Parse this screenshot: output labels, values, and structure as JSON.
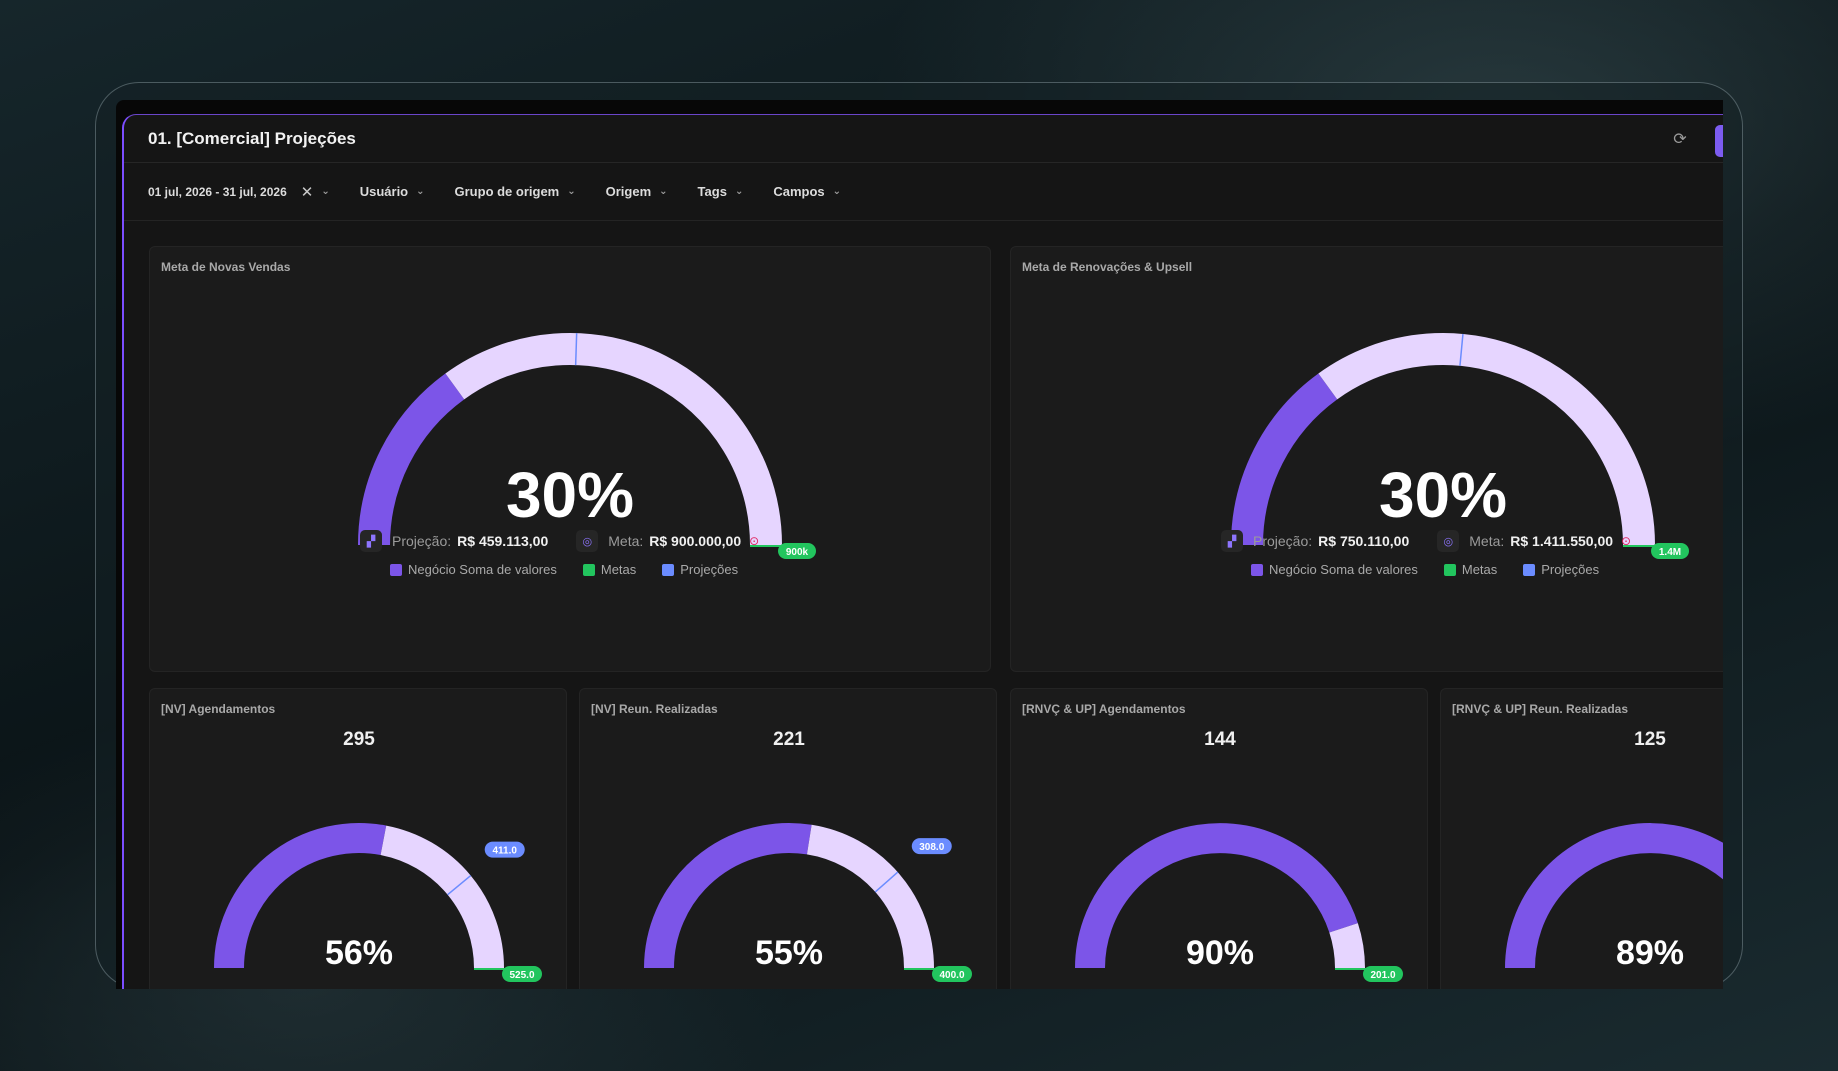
{
  "header": {
    "title": "01. [Comercial] Projeções"
  },
  "filters": {
    "date_range": "01 jul, 2026 - 31 jul, 2026",
    "items": [
      "Usuário",
      "Grupo de origem",
      "Origem",
      "Tags",
      "Campos"
    ]
  },
  "legend": {
    "series": [
      {
        "name": "Negócio Soma de valores",
        "color": "#7c55e8"
      },
      {
        "name": "Metas",
        "color": "#22c55e"
      },
      {
        "name": "Projeções",
        "color": "#6b8cff"
      }
    ]
  },
  "big_cards": [
    {
      "title": "Meta de Novas Vendas",
      "percent_label": "30%",
      "achieved_fraction": 0.3,
      "projection_fraction": 0.51,
      "goal_pill": "900k",
      "projection_label": "Projeção:",
      "projection_value": "R$ 459.113,00",
      "meta_label": "Meta:",
      "meta_value": "R$ 900.000,00"
    },
    {
      "title": "Meta de Renovações & Upsell",
      "percent_label": "30%",
      "achieved_fraction": 0.3,
      "projection_fraction": 0.53,
      "goal_pill": "1.4M",
      "projection_label": "Projeção:",
      "projection_value": "R$ 750.110,00",
      "meta_label": "Meta:",
      "meta_value": "R$ 1.411.550,00"
    }
  ],
  "small_cards": [
    {
      "title": "[NV] Agendamentos",
      "count": "295",
      "percent_label": "56%",
      "achieved_fraction": 0.56,
      "projection_fraction": 0.78,
      "projection_pill": "411.0",
      "goal_pill": "525.0"
    },
    {
      "title": "[NV] Reun. Realizadas",
      "count": "221",
      "percent_label": "55%",
      "achieved_fraction": 0.55,
      "projection_fraction": 0.77,
      "projection_pill": "308.0",
      "goal_pill": "400.0"
    },
    {
      "title": "[RNVÇ & UP] Agendamentos",
      "count": "144",
      "percent_label": "90%",
      "achieved_fraction": 0.9,
      "projection_fraction": 1.0,
      "projection_pill": "",
      "goal_pill": "201.0"
    },
    {
      "title": "[RNVÇ & UP] Reun. Realizadas",
      "count": "125",
      "percent_label": "89%",
      "achieved_fraction": 0.89,
      "projection_fraction": 1.0,
      "projection_pill": "",
      "goal_pill": ""
    }
  ],
  "colors": {
    "achieved": "#7c55e8",
    "remaining": "#e6d5ff",
    "goal": "#22c55e",
    "projection": "#6b8cff",
    "accent": "#7c4dff"
  }
}
